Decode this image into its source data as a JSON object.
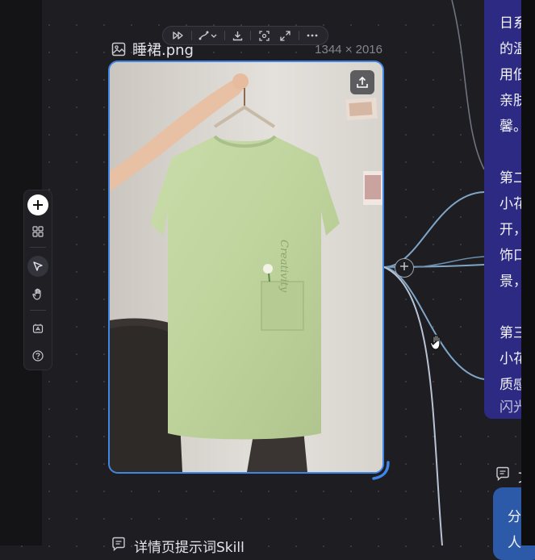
{
  "image_node": {
    "filename": "睡裙.png",
    "dimensions": "1344 × 2016",
    "image_icon": "image-icon",
    "upload_icon": "upload-icon",
    "photo_text": "Creativity"
  },
  "image_toolbar": {
    "buttons": [
      "play-forward-icon",
      "style-dropdown-icon",
      "download-icon",
      "focus-icon",
      "expand-icon",
      "more-icon"
    ]
  },
  "left_toolbar": {
    "items": [
      "add-icon",
      "grid-icon",
      "select-cursor-icon",
      "hand-icon",
      "translate-icon",
      "help-icon"
    ],
    "selected": "select-cursor-icon"
  },
  "right_text_card": {
    "lines": [
      "日系",
      "的温",
      "用低",
      "亲肤",
      "馨。",
      "",
      "第二",
      "小花",
      "开，",
      "饰口",
      "景，",
      "",
      "第三",
      "小花",
      "质感",
      "闪光"
    ]
  },
  "right_node2": {
    "icon": "notes-icon",
    "label": "文",
    "lines": [
      "分",
      "人"
    ]
  },
  "bottom_node": {
    "icon": "notes-icon",
    "label": "详情页提示词Skill"
  },
  "colors": {
    "canvas_bg": "#1d1d22",
    "selection_blue": "#3f86e6",
    "purple_card": "#2d2a84",
    "blue_card": "#2d5aa8"
  }
}
